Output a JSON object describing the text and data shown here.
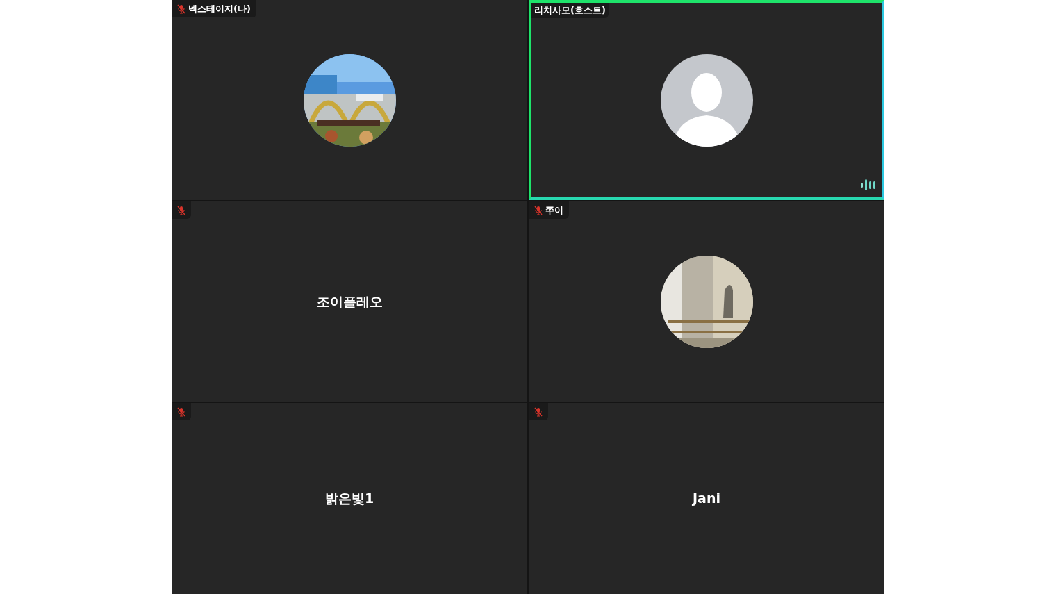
{
  "tiles": [
    {
      "tag": "넥스테이지(나)",
      "muted": true,
      "speaking": false
    },
    {
      "tag": "리치사모(호스트)",
      "muted": false,
      "speaking": true,
      "display": {
        "kind": "avatar"
      }
    },
    {
      "muted": true,
      "speaking": false,
      "display": {
        "kind": "name",
        "text": "조이플레오"
      }
    },
    {
      "tag": "쭈이",
      "muted": true,
      "speaking": false
    },
    {
      "muted": true,
      "speaking": false,
      "display": {
        "kind": "name",
        "text": "밝은빛1"
      }
    },
    {
      "muted": true,
      "speaking": false,
      "display": {
        "kind": "name",
        "text": "Jani"
      }
    }
  ]
}
